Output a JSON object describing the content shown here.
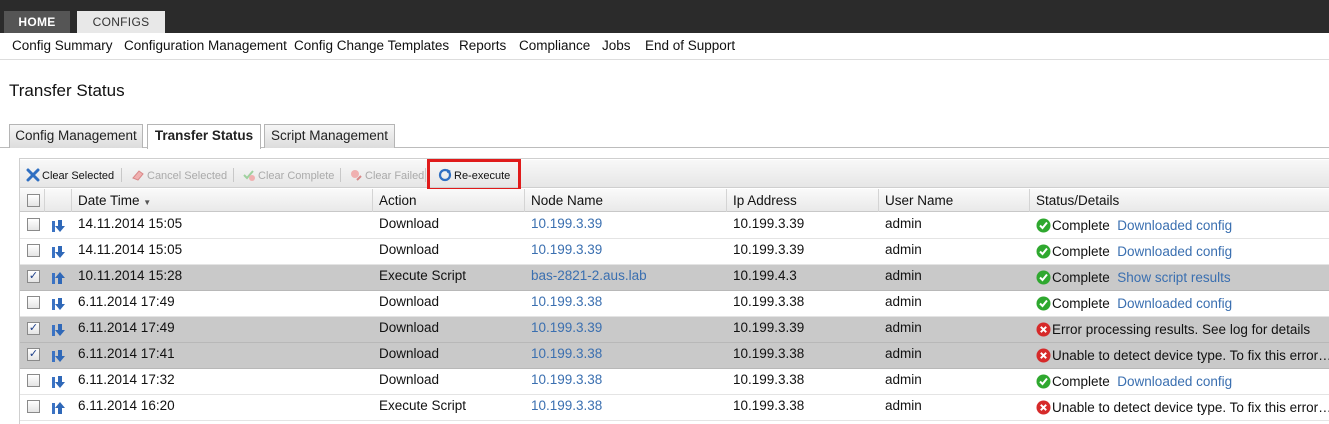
{
  "topnav": {
    "home": "HOME",
    "configs": "CONFIGS"
  },
  "menu": [
    "Config Summary",
    "Configuration Management",
    "Config Change Templates",
    "Reports",
    "Compliance",
    "Jobs",
    "End of Support"
  ],
  "page_title": "Transfer Status",
  "subtabs": [
    "Config Management",
    "Transfer Status",
    "Script Management"
  ],
  "toolbar": {
    "clear_selected": "Clear Selected",
    "cancel_selected": "Cancel Selected",
    "clear_complete": "Clear Complete",
    "clear_failed": "Clear Failed",
    "re_execute": "Re-execute"
  },
  "columns": [
    "Date Time",
    "Action",
    "Node Name",
    "Ip Address",
    "User Name",
    "Status/Details"
  ],
  "colors": {
    "link": "#3a6fb0",
    "highlight": "#e01b1b",
    "ok": "#2fa82f",
    "error": "#d62a2a",
    "selected_row": "#c9c9c9"
  },
  "rows": [
    {
      "checked": false,
      "direction": "down",
      "date": "14.11.2014 15:05",
      "action": "Download",
      "node": "10.199.3.39",
      "ip": "10.199.3.39",
      "user": "admin",
      "status_icon": "ok",
      "status": "Complete",
      "detail": "Downloaded config"
    },
    {
      "checked": false,
      "direction": "down",
      "date": "14.11.2014 15:05",
      "action": "Download",
      "node": "10.199.3.39",
      "ip": "10.199.3.39",
      "user": "admin",
      "status_icon": "ok",
      "status": "Complete",
      "detail": "Downloaded config"
    },
    {
      "checked": true,
      "direction": "up",
      "date": "10.11.2014 15:28",
      "action": "Execute Script",
      "node": "bas-2821-2.aus.lab",
      "ip": "10.199.4.3",
      "user": "admin",
      "status_icon": "ok",
      "status": "Complete",
      "detail": "Show script results"
    },
    {
      "checked": false,
      "direction": "down",
      "date": "6.11.2014 17:49",
      "action": "Download",
      "node": "10.199.3.38",
      "ip": "10.199.3.38",
      "user": "admin",
      "status_icon": "ok",
      "status": "Complete",
      "detail": "Downloaded config"
    },
    {
      "checked": true,
      "direction": "down",
      "date": "6.11.2014 17:49",
      "action": "Download",
      "node": "10.199.3.39",
      "ip": "10.199.3.39",
      "user": "admin",
      "status_icon": "error",
      "status": "Error processing results. See log for details",
      "detail": ""
    },
    {
      "checked": true,
      "direction": "down",
      "date": "6.11.2014 17:41",
      "action": "Download",
      "node": "10.199.3.38",
      "ip": "10.199.3.38",
      "user": "admin",
      "status_icon": "error",
      "status": "Unable to detect device type. To fix this error…",
      "detail": ""
    },
    {
      "checked": false,
      "direction": "down",
      "date": "6.11.2014 17:32",
      "action": "Download",
      "node": "10.199.3.38",
      "ip": "10.199.3.38",
      "user": "admin",
      "status_icon": "ok",
      "status": "Complete",
      "detail": "Downloaded config"
    },
    {
      "checked": false,
      "direction": "up",
      "date": "6.11.2014 16:20",
      "action": "Execute Script",
      "node": "10.199.3.38",
      "ip": "10.199.3.38",
      "user": "admin",
      "status_icon": "error",
      "status": "Unable to detect device type. To fix this error…",
      "detail": ""
    }
  ]
}
